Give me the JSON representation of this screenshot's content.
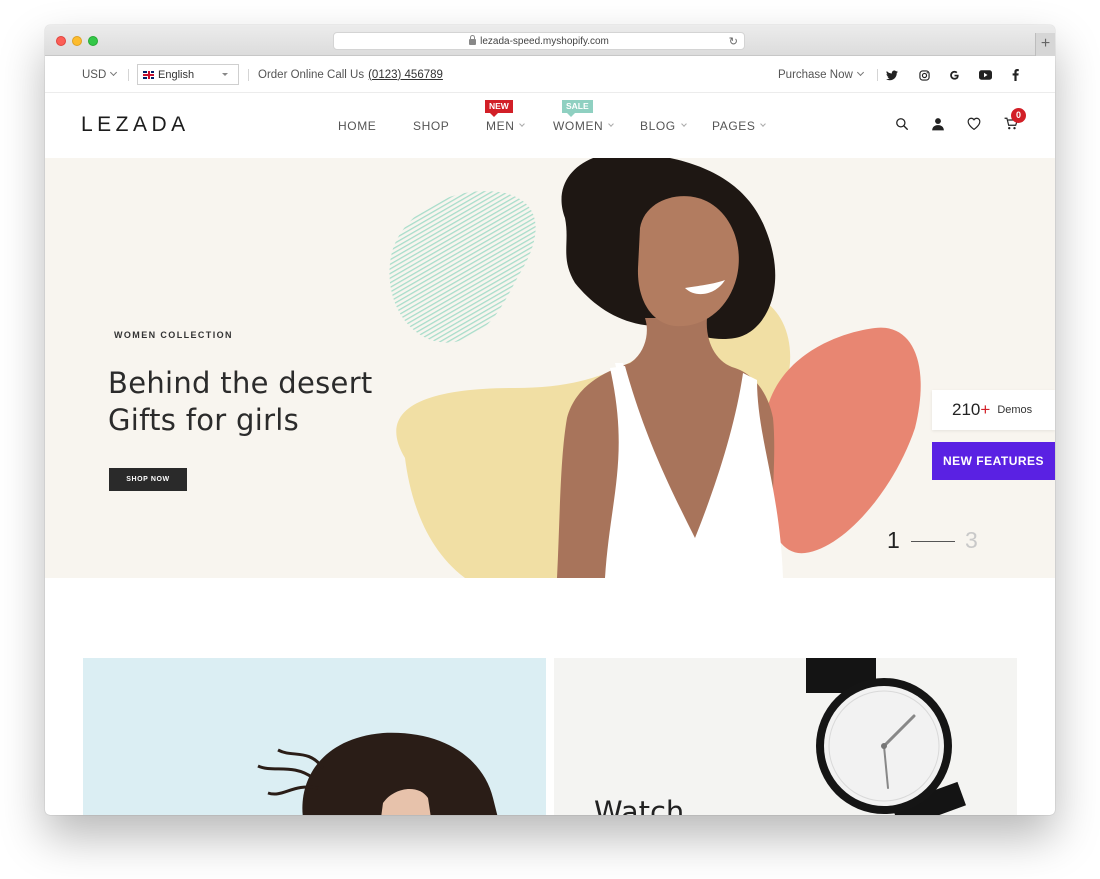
{
  "browser": {
    "url": "lezada-speed.myshopify.com"
  },
  "topbar": {
    "currency": "USD",
    "language": "English",
    "order_text": "Order Online Call Us",
    "phone": "(0123) 456789",
    "purchase_now": "Purchase Now",
    "social_icons": [
      "twitter-icon",
      "instagram-icon",
      "google-icon",
      "youtube-icon",
      "facebook-icon"
    ]
  },
  "header": {
    "logo": "LEZADA",
    "nav": [
      {
        "label": "HOME"
      },
      {
        "label": "SHOP"
      },
      {
        "label": "MEN",
        "badge": "NEW"
      },
      {
        "label": "WOMEN",
        "badge": "SALE"
      },
      {
        "label": "BLOG"
      },
      {
        "label": "PAGES"
      }
    ],
    "cart_count": "0"
  },
  "hero": {
    "kicker": "WOMEN COLLECTION",
    "title_line1": "Behind the desert",
    "title_line2": "Gifts for girls",
    "button": "SHOP NOW",
    "demos_count": "210",
    "demos_plus": "+",
    "demos_label": "Demos",
    "features_button": "NEW FEATURES",
    "slide_current": "1",
    "slide_total": "3"
  },
  "banners": {
    "right_title": "Watch"
  },
  "colors": {
    "accent_red": "#d21f27",
    "sale_teal": "#8fd0c1",
    "features_purple": "#5a21e3",
    "hero_bg": "#f8f5ef"
  }
}
